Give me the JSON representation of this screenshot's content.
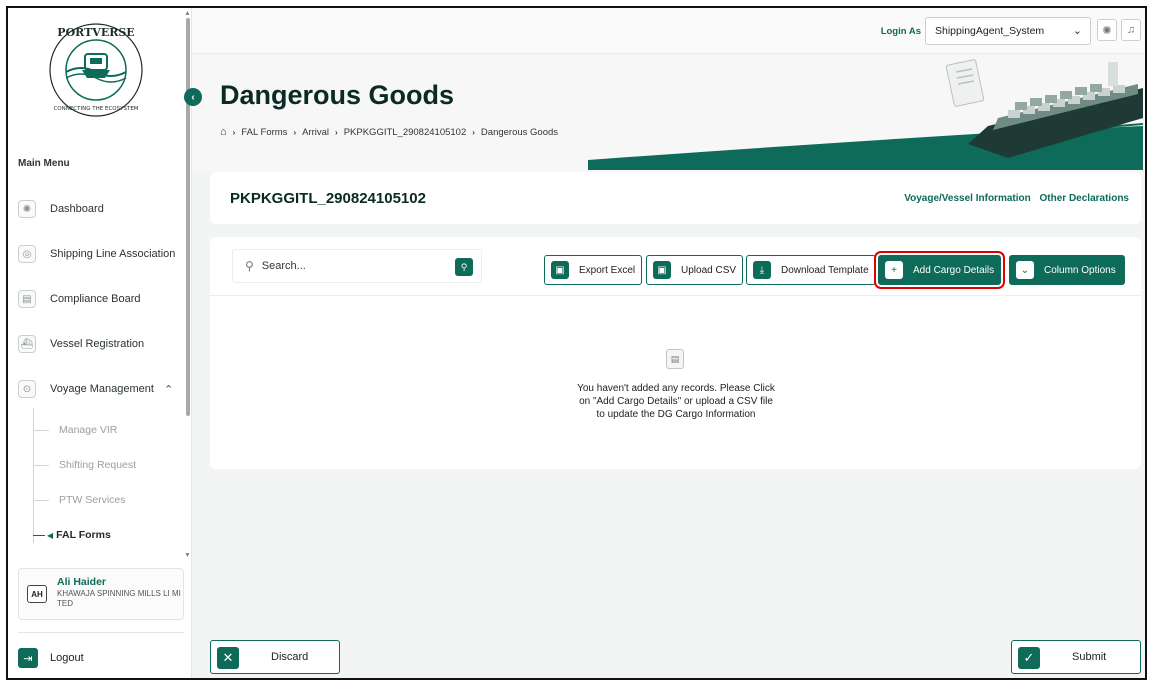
{
  "colors": {
    "accent": "#0e6b5a",
    "highlight": "#e00000"
  },
  "sidebar": {
    "logo_text": "PORTVERSE",
    "logo_tagline": "CONNECTING THE ECOSYSTEM",
    "main_menu_title": "Main Menu",
    "items": [
      {
        "label": "Dashboard",
        "icon": "gear-icon"
      },
      {
        "label": "Shipping Line Association",
        "icon": "globe-icon"
      },
      {
        "label": "Compliance Board",
        "icon": "document-icon"
      },
      {
        "label": "Vessel Registration",
        "icon": "ship-icon"
      },
      {
        "label": "Voyage Management",
        "icon": "location-icon"
      }
    ],
    "sub_items": [
      {
        "label": "Manage VIR"
      },
      {
        "label": "Shifting Request"
      },
      {
        "label": "PTW Services"
      },
      {
        "label": "FAL Forms"
      }
    ],
    "user": {
      "initials": "AH",
      "name": "Ali Haider",
      "org": "KHAWAJA SPINNING MILLS LI MITED"
    },
    "logout_label": "Logout"
  },
  "header": {
    "login_as_label": "Login As",
    "selected_user": "ShippingAgent_System"
  },
  "page": {
    "title": "Dangerous Goods",
    "breadcrumb": [
      "FAL Forms",
      "Arrival",
      "PKPKGGITL_290824105102",
      "Dangerous Goods"
    ]
  },
  "voyage": {
    "id": "PKPKGGITL_290824105102",
    "links": [
      "Voyage/Vessel Information",
      "Other Declarations"
    ]
  },
  "toolbar": {
    "search_placeholder": "Search...",
    "export_excel": "Export Excel",
    "upload_csv": "Upload CSV",
    "download_template": "Download Template",
    "add_cargo": "Add Cargo Details",
    "column_options": "Column Options"
  },
  "empty_state": {
    "line1": "You haven't added any records. Please Click",
    "line2": "on \"Add Cargo Details\" or upload a CSV file",
    "line3": "to update the DG Cargo Information"
  },
  "footer": {
    "discard": "Discard",
    "submit": "Submit"
  }
}
